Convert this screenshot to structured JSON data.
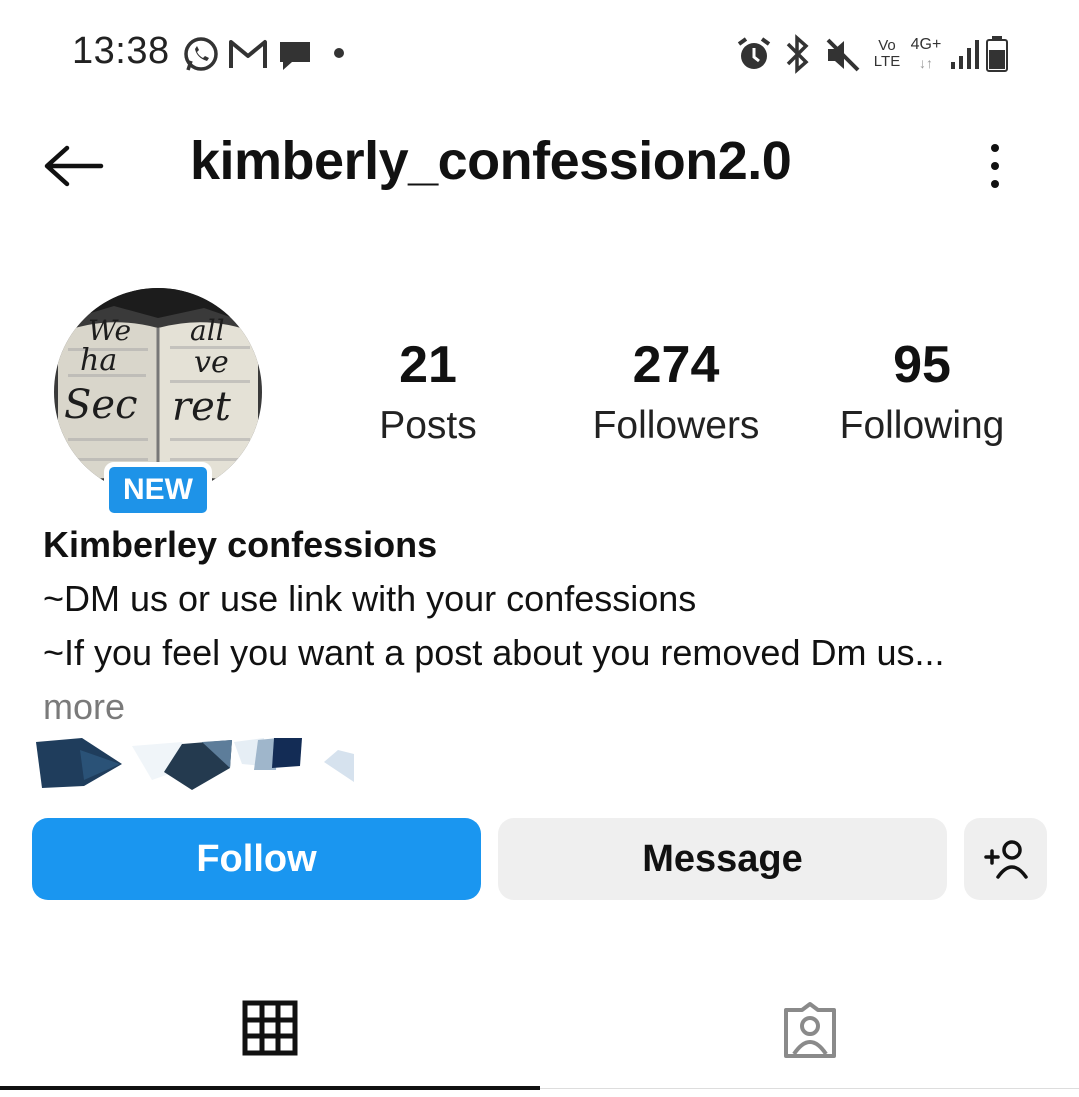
{
  "status_bar": {
    "time": "13:38",
    "left_icons": [
      "whatsapp-icon",
      "gmail-icon",
      "chat-icon",
      "dot-icon"
    ],
    "right_icons": [
      "alarm-icon",
      "bluetooth-icon",
      "mute-icon",
      "volte-icon",
      "4g-plus-icon",
      "signal-icon",
      "battery-icon"
    ],
    "volte_top": "Vo",
    "volte_bottom": "LTE",
    "network": "4G+"
  },
  "header": {
    "title": "kimberly_confession2.0"
  },
  "profile": {
    "avatar_words": [
      "We",
      "all",
      "ha",
      "ve",
      "Sec",
      "ret"
    ],
    "new_badge": "NEW",
    "stats": [
      {
        "count": "21",
        "label": "Posts"
      },
      {
        "count": "274",
        "label": "Followers"
      },
      {
        "count": "95",
        "label": "Following"
      }
    ],
    "bio": {
      "name": "Kimberley confessions",
      "line1": "~DM us or use link with your confessions",
      "line2": "~If you feel you want a post about you removed Dm us...",
      "more": "more"
    }
  },
  "actions": {
    "follow": "Follow",
    "message": "Message"
  },
  "tabs": [
    "grid-icon",
    "tagged-icon"
  ],
  "colors": {
    "accent": "#1a96f0",
    "badge": "#1e93e8",
    "secondary_button": "#efefef",
    "muted_text": "#7a7a7a"
  }
}
